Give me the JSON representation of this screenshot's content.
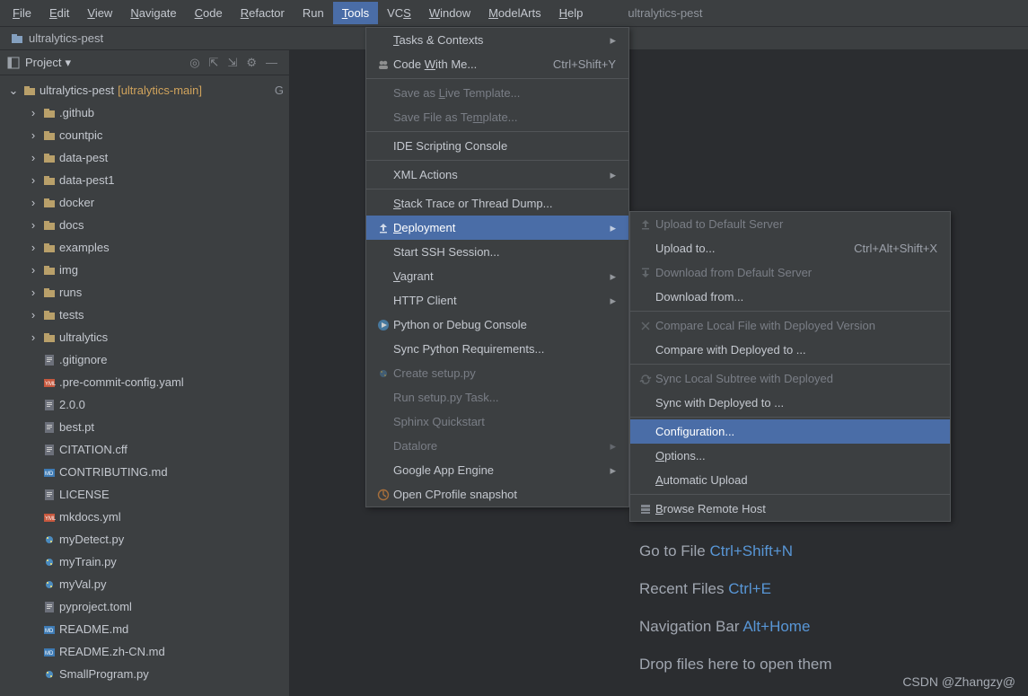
{
  "menubar": {
    "items": [
      {
        "label": "File",
        "u": 0
      },
      {
        "label": "Edit",
        "u": 0
      },
      {
        "label": "View",
        "u": 0
      },
      {
        "label": "Navigate",
        "u": 0
      },
      {
        "label": "Code",
        "u": 0
      },
      {
        "label": "Refactor",
        "u": 0
      },
      {
        "label": "Run",
        "u": -1
      },
      {
        "label": "Tools",
        "u": 0,
        "active": true
      },
      {
        "label": "VCS",
        "u": 2
      },
      {
        "label": "Window",
        "u": 0
      },
      {
        "label": "ModelArts",
        "u": 0
      },
      {
        "label": "Help",
        "u": 0
      }
    ],
    "project_title": "ultralytics-pest"
  },
  "breadcrumb": {
    "label": "ultralytics-pest"
  },
  "sidebar": {
    "project_label": "Project",
    "tree": [
      {
        "depth": 0,
        "arrow": "down",
        "icon": "folder",
        "label": "ultralytics-pest",
        "suffix": " [ultralytics-main]",
        "tail": "G"
      },
      {
        "depth": 1,
        "arrow": "right",
        "icon": "folder",
        "label": ".github"
      },
      {
        "depth": 1,
        "arrow": "right",
        "icon": "folder",
        "label": "countpic"
      },
      {
        "depth": 1,
        "arrow": "right",
        "icon": "folder",
        "label": "data-pest"
      },
      {
        "depth": 1,
        "arrow": "right",
        "icon": "folder",
        "label": "data-pest1"
      },
      {
        "depth": 1,
        "arrow": "right",
        "icon": "folder",
        "label": "docker"
      },
      {
        "depth": 1,
        "arrow": "right",
        "icon": "folder",
        "label": "docs"
      },
      {
        "depth": 1,
        "arrow": "right",
        "icon": "folder",
        "label": "examples"
      },
      {
        "depth": 1,
        "arrow": "right",
        "icon": "folder",
        "label": "img"
      },
      {
        "depth": 1,
        "arrow": "right",
        "icon": "folder",
        "label": "runs"
      },
      {
        "depth": 1,
        "arrow": "right",
        "icon": "folder",
        "label": "tests"
      },
      {
        "depth": 1,
        "arrow": "right",
        "icon": "folder",
        "label": "ultralytics"
      },
      {
        "depth": 1,
        "arrow": "",
        "icon": "txt",
        "label": ".gitignore"
      },
      {
        "depth": 1,
        "arrow": "",
        "icon": "yml",
        "label": ".pre-commit-config.yaml"
      },
      {
        "depth": 1,
        "arrow": "",
        "icon": "txt",
        "label": "2.0.0"
      },
      {
        "depth": 1,
        "arrow": "",
        "icon": "txt",
        "label": "best.pt"
      },
      {
        "depth": 1,
        "arrow": "",
        "icon": "txt",
        "label": "CITATION.cff"
      },
      {
        "depth": 1,
        "arrow": "",
        "icon": "md",
        "label": "CONTRIBUTING.md"
      },
      {
        "depth": 1,
        "arrow": "",
        "icon": "txt",
        "label": "LICENSE"
      },
      {
        "depth": 1,
        "arrow": "",
        "icon": "yml",
        "label": "mkdocs.yml"
      },
      {
        "depth": 1,
        "arrow": "",
        "icon": "py",
        "label": "myDetect.py"
      },
      {
        "depth": 1,
        "arrow": "",
        "icon": "py",
        "label": "myTrain.py"
      },
      {
        "depth": 1,
        "arrow": "",
        "icon": "py",
        "label": "myVal.py"
      },
      {
        "depth": 1,
        "arrow": "",
        "icon": "txt",
        "label": "pyproject.toml"
      },
      {
        "depth": 1,
        "arrow": "",
        "icon": "md",
        "label": "README.md"
      },
      {
        "depth": 1,
        "arrow": "",
        "icon": "md",
        "label": "README.zh-CN.md"
      },
      {
        "depth": 1,
        "arrow": "",
        "icon": "py",
        "label": "SmallProgram.py"
      }
    ]
  },
  "tools_menu": [
    {
      "t": "item",
      "label": "Tasks & Contexts",
      "u": 0,
      "sub": true
    },
    {
      "t": "item",
      "icon": "people",
      "label": "Code With Me...",
      "u": 5,
      "shortcut": "Ctrl+Shift+Y"
    },
    {
      "t": "sep"
    },
    {
      "t": "item",
      "label": "Save as Live Template...",
      "u": 8,
      "disabled": true
    },
    {
      "t": "item",
      "label": "Save File as Template...",
      "u": 15,
      "disabled": true
    },
    {
      "t": "sep"
    },
    {
      "t": "item",
      "label": "IDE Scripting Console"
    },
    {
      "t": "sep"
    },
    {
      "t": "item",
      "label": "XML Actions",
      "sub": true
    },
    {
      "t": "sep"
    },
    {
      "t": "item",
      "label": "Stack Trace or Thread Dump...",
      "u": 0
    },
    {
      "t": "item",
      "icon": "deploy",
      "label": "Deployment",
      "u": 0,
      "sub": true,
      "selected": true
    },
    {
      "t": "item",
      "label": "Start SSH Session..."
    },
    {
      "t": "item",
      "label": "Vagrant",
      "u": 0,
      "sub": true
    },
    {
      "t": "item",
      "label": "HTTP Client",
      "sub": true
    },
    {
      "t": "item",
      "icon": "pyrun",
      "label": "Python or Debug Console"
    },
    {
      "t": "item",
      "label": "Sync Python Requirements..."
    },
    {
      "t": "item",
      "icon": "py",
      "label": "Create setup.py",
      "disabled": true
    },
    {
      "t": "item",
      "label": "Run setup.py Task...",
      "disabled": true
    },
    {
      "t": "item",
      "label": "Sphinx Quickstart",
      "disabled": true
    },
    {
      "t": "item",
      "label": "Datalore",
      "disabled": true,
      "sub": true
    },
    {
      "t": "item",
      "label": "Google App Engine",
      "sub": true
    },
    {
      "t": "item",
      "icon": "profile",
      "label": "Open CProfile snapshot"
    }
  ],
  "deploy_menu": [
    {
      "t": "item",
      "icon": "upload",
      "label": "Upload to Default Server",
      "disabled": true
    },
    {
      "t": "item",
      "label": "Upload to...",
      "shortcut": "Ctrl+Alt+Shift+X"
    },
    {
      "t": "item",
      "icon": "download",
      "label": "Download from Default Server",
      "disabled": true
    },
    {
      "t": "item",
      "label": "Download from..."
    },
    {
      "t": "sep"
    },
    {
      "t": "item",
      "icon": "compare",
      "label": "Compare Local File with Deployed Version",
      "disabled": true
    },
    {
      "t": "item",
      "label": "Compare with Deployed to ..."
    },
    {
      "t": "sep"
    },
    {
      "t": "item",
      "icon": "sync",
      "label": "Sync Local Subtree with Deployed",
      "disabled": true
    },
    {
      "t": "item",
      "label": "Sync with Deployed to ..."
    },
    {
      "t": "sep"
    },
    {
      "t": "item",
      "label": "Configuration...",
      "selected": true
    },
    {
      "t": "item",
      "label": "Options...",
      "u": 0
    },
    {
      "t": "item",
      "label": "Automatic Upload",
      "u": 0
    },
    {
      "t": "sep"
    },
    {
      "t": "item",
      "icon": "host",
      "label": "Browse Remote Host",
      "u": 0
    }
  ],
  "tips": [
    {
      "label": "Go to File",
      "key": "Ctrl+Shift+N"
    },
    {
      "label": "Recent Files",
      "key": "Ctrl+E"
    },
    {
      "label": "Navigation Bar",
      "key": "Alt+Home"
    },
    {
      "label": "Drop files here to open them",
      "key": ""
    }
  ],
  "watermark": "CSDN @Zhangzy@"
}
